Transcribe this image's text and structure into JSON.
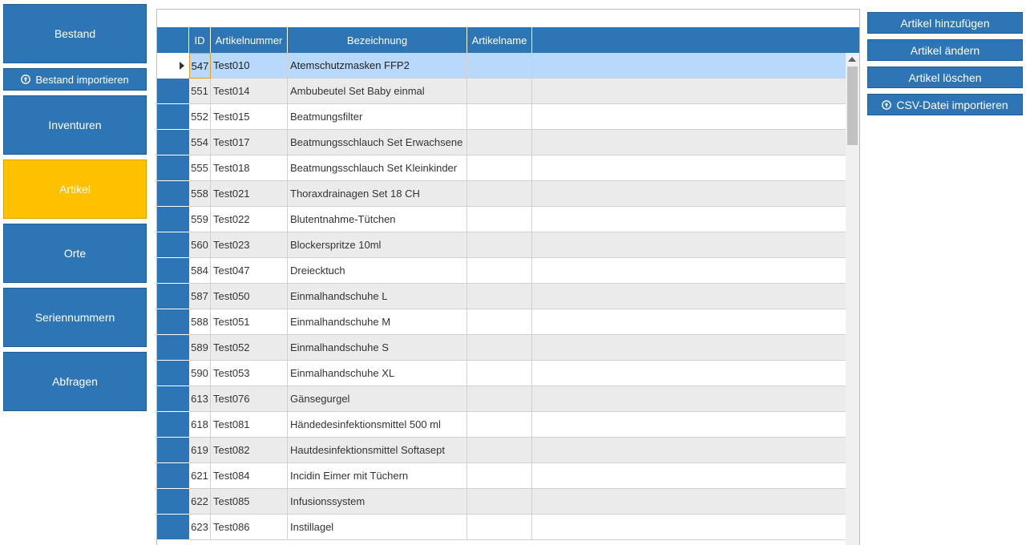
{
  "nav": {
    "bestand": "Bestand",
    "bestand_importieren": "Bestand importieren",
    "inventuren": "Inventuren",
    "artikel": "Artikel",
    "orte": "Orte",
    "seriennummern": "Seriennummern",
    "abfragen": "Abfragen"
  },
  "actions": {
    "add": "Artikel hinzufügen",
    "edit": "Artikel ändern",
    "delete": "Artikel löschen",
    "csv_import": "CSV-Datei importieren"
  },
  "filter": {
    "value": ""
  },
  "grid": {
    "columns": {
      "id": "ID",
      "num": "Artikelnummer",
      "bez": "Bezeichnung",
      "name": "Artikelname"
    },
    "rows": [
      {
        "id": "547",
        "num": "Test010",
        "bez": "Atemschutzmasken FFP2",
        "name": ""
      },
      {
        "id": "551",
        "num": "Test014",
        "bez": "Ambubeutel Set Baby einmal",
        "name": ""
      },
      {
        "id": "552",
        "num": "Test015",
        "bez": "Beatmungsfilter",
        "name": ""
      },
      {
        "id": "554",
        "num": "Test017",
        "bez": "Beatmungsschlauch Set Erwachsene",
        "name": ""
      },
      {
        "id": "555",
        "num": "Test018",
        "bez": "Beatmungsschlauch Set Kleinkinder",
        "name": ""
      },
      {
        "id": "558",
        "num": "Test021",
        "bez": "Thoraxdrainagen Set 18 CH",
        "name": ""
      },
      {
        "id": "559",
        "num": "Test022",
        "bez": "Blutentnahme-Tütchen",
        "name": ""
      },
      {
        "id": "560",
        "num": "Test023",
        "bez": "Blockerspritze 10ml",
        "name": ""
      },
      {
        "id": "584",
        "num": "Test047",
        "bez": "Dreiecktuch",
        "name": ""
      },
      {
        "id": "587",
        "num": "Test050",
        "bez": "Einmalhandschuhe L",
        "name": ""
      },
      {
        "id": "588",
        "num": "Test051",
        "bez": "Einmalhandschuhe M",
        "name": ""
      },
      {
        "id": "589",
        "num": "Test052",
        "bez": "Einmalhandschuhe S",
        "name": ""
      },
      {
        "id": "590",
        "num": "Test053",
        "bez": "Einmalhandschuhe XL",
        "name": ""
      },
      {
        "id": "613",
        "num": "Test076",
        "bez": "Gänsegurgel",
        "name": ""
      },
      {
        "id": "618",
        "num": "Test081",
        "bez": "Händedesinfektionsmittel 500 ml",
        "name": ""
      },
      {
        "id": "619",
        "num": "Test082",
        "bez": "Hautdesinfektionsmittel Softasept",
        "name": ""
      },
      {
        "id": "621",
        "num": "Test084",
        "bez": "Incidin Eimer mit Tüchern",
        "name": ""
      },
      {
        "id": "622",
        "num": "Test085",
        "bez": "Infusionssystem",
        "name": ""
      },
      {
        "id": "623",
        "num": "Test086",
        "bez": "Instillagel",
        "name": ""
      }
    ]
  },
  "colors": {
    "primary": "#2e75b6",
    "active": "#ffc000",
    "selected_row": "#b8d9fb",
    "alt_row": "#ebebeb"
  },
  "icons": {
    "upload": "upload-circle-icon",
    "row_indicator": "current-row-arrow-icon"
  }
}
